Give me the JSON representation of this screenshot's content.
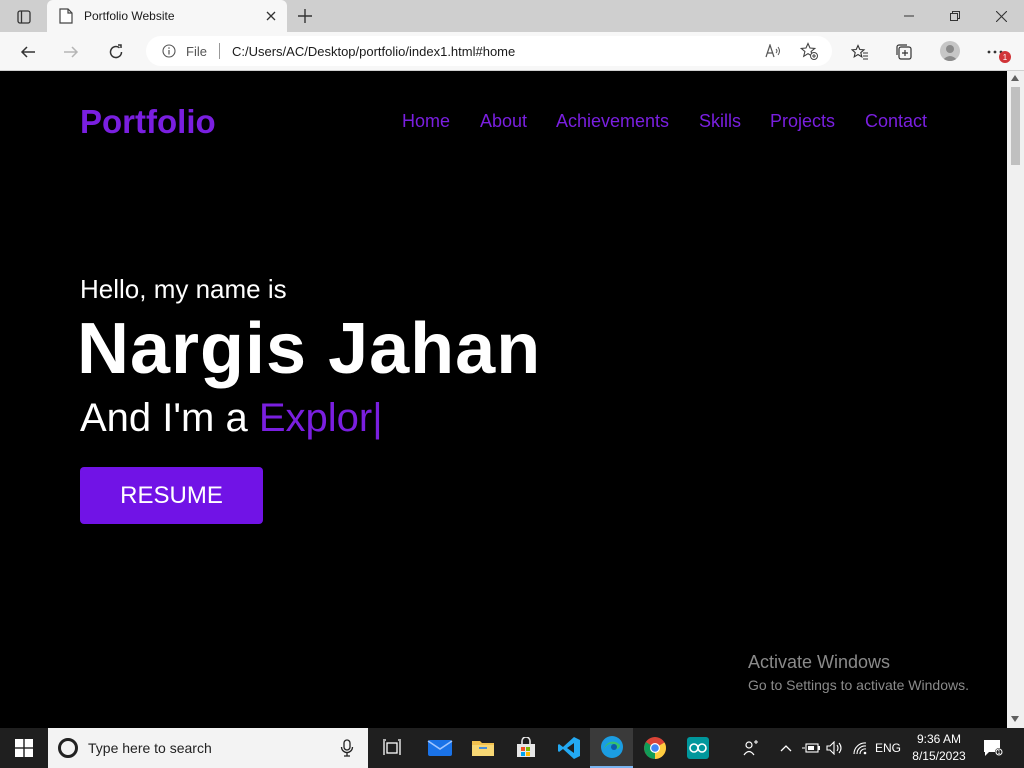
{
  "browser": {
    "tab_title": "Portfolio Website",
    "address_scheme_label": "File",
    "url": "C:/Users/AC/Desktop/portfolio/index1.html#home",
    "notification_badge": "1"
  },
  "page": {
    "logo": "Portfolio",
    "nav": [
      {
        "label": "Home"
      },
      {
        "label": "About"
      },
      {
        "label": "Achievements"
      },
      {
        "label": "Skills"
      },
      {
        "label": "Projects"
      },
      {
        "label": "Contact"
      }
    ],
    "hello": "Hello, my name is",
    "name": "Nargis Jahan",
    "role_prefix": "And I'm a ",
    "role_typed": "Explor",
    "role_cursor": "|",
    "resume_button": "RESUME",
    "accent_color": "#7a1fe0",
    "background_color": "#000000"
  },
  "watermark": {
    "title": "Activate Windows",
    "subtitle": "Go to Settings to activate Windows."
  },
  "taskbar": {
    "search_placeholder": "Type here to search",
    "language": "ENG",
    "time": "9:36 AM",
    "date": "8/15/2023"
  }
}
